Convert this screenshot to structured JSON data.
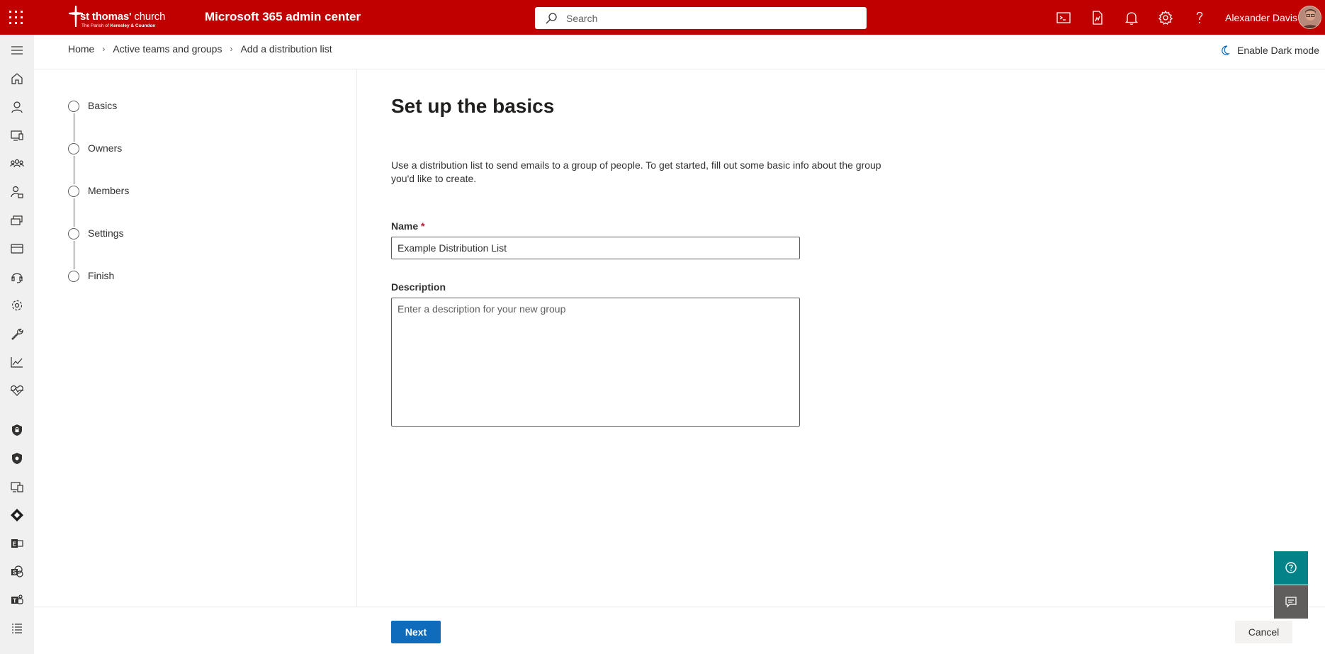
{
  "topbar": {
    "logo": {
      "name_bold": "st thomas'",
      "name_regular": " church",
      "sub_prefix": "The Parish of ",
      "sub_bold": "Keresley & Coundon"
    },
    "app_title": "Microsoft 365 admin center",
    "search_placeholder": "Search",
    "user_name": "Alexander Davis",
    "icons": [
      "app-launcher-icon",
      "terminal-icon",
      "mobile-app-icon",
      "bell-icon",
      "gear-icon",
      "help-icon"
    ],
    "brand_color": "#c00000"
  },
  "leftnav": {
    "items": [
      "menu-icon",
      "home-icon",
      "user-icon",
      "devices-icon",
      "teams-icon",
      "roles-icon",
      "resources-icon",
      "billing-icon",
      "support-icon",
      "settings-icon",
      "setup-icon",
      "reports-icon",
      "health-icon",
      "security-icon",
      "compliance-icon",
      "endpoint-manager-icon",
      "azure-ad-icon",
      "exchange-icon",
      "sharepoint-icon",
      "teams-app-icon",
      "all-admin-centers-icon"
    ]
  },
  "breadcrumb": {
    "items": [
      "Home",
      "Active teams and groups",
      "Add a distribution list"
    ]
  },
  "dark_mode_label": "Enable Dark mode",
  "steps": [
    "Basics",
    "Owners",
    "Members",
    "Settings",
    "Finish"
  ],
  "main": {
    "title": "Set up the basics",
    "intro": "Use a distribution list to send emails to a group of people. To get started, fill out some basic info about the group you'd like to create.",
    "name_label": "Name",
    "required_marker": "*",
    "name_value": "Example Distribution List",
    "description_label": "Description",
    "description_placeholder": "Enter a description for your new group"
  },
  "footer": {
    "next_label": "Next",
    "cancel_label": "Cancel",
    "primary_color": "#0f6cbd"
  },
  "floating": {
    "help_color": "#038387",
    "feedback_color": "#605e5c"
  }
}
